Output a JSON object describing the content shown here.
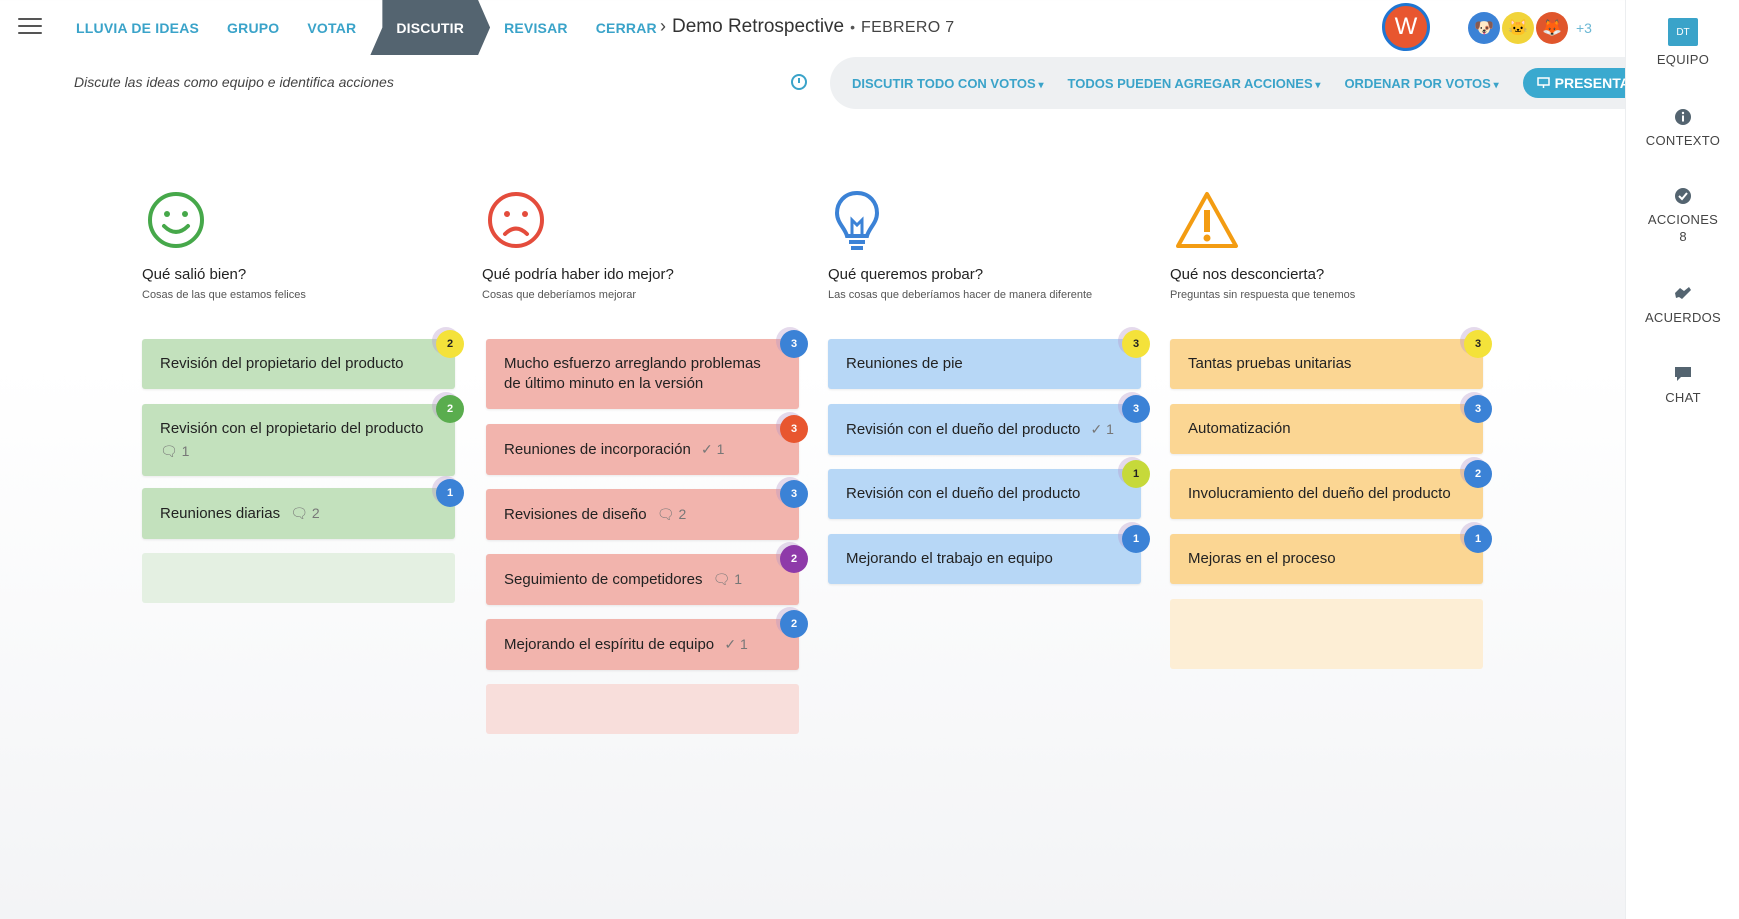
{
  "nav": {
    "steps": [
      {
        "label": "LLUVIA DE IDEAS"
      },
      {
        "label": "GRUPO"
      },
      {
        "label": "VOTAR"
      },
      {
        "label": "DISCUTIR"
      },
      {
        "label": "REVISAR"
      },
      {
        "label": "CERRAR"
      }
    ],
    "active_step": "DISCUTIR"
  },
  "header": {
    "chevron": "›",
    "title": "Demo Retrospective",
    "separator": "•",
    "date": "FEBRERO 7",
    "user_initial": "W",
    "more_participants": "+3"
  },
  "subbar": {
    "subtitle": "Discute las ideas como equipo e identifica acciones",
    "discuss_all": "DISCUTIR TODO CON VOTOS",
    "add_actions": "TODOS PUEDEN AGREGAR ACCIONES",
    "sort": "ORDENAR POR VOTOS",
    "present": "PRESENTAR"
  },
  "sidebar": {
    "team_badge": "DT",
    "team_label": "EQUIPO",
    "context_label": "CONTEXTO",
    "actions_label": "ACCIONES",
    "actions_count": "8",
    "agreements_label": "ACUERDOS",
    "chat_label": "CHAT"
  },
  "columns": [
    {
      "title": "Qué salió bien?",
      "subtitle": "Cosas de las que estamos felices",
      "icon": "smiley-icon",
      "color": "#c3e1bd",
      "cards": [
        {
          "text": "Revisión del propietario del producto",
          "votes": "2",
          "vote_color": "#f4e23a"
        },
        {
          "text": "Revisión con el propietario del producto",
          "comments": "1",
          "votes": "2",
          "vote_color": "#5aad4e"
        },
        {
          "text": "Reuniones diarias",
          "comments": "2",
          "votes": "1",
          "vote_color": "#3b82d6"
        }
      ]
    },
    {
      "title": "Qué podría haber ido mejor?",
      "subtitle": "Cosas que deberíamos mejorar",
      "icon": "sad-face-icon",
      "color": "#f2b4ad",
      "cards": [
        {
          "text": "Mucho esfuerzo arreglando problemas de último minuto en la versión",
          "votes": "3",
          "vote_color": "#3b82d6"
        },
        {
          "text": "Reuniones de incorporación",
          "actions": "1",
          "votes": "3",
          "vote_color": "#e8562f"
        },
        {
          "text": "Revisiones de diseño",
          "comments": "2",
          "votes": "3",
          "vote_color": "#3b82d6"
        },
        {
          "text": "Seguimiento de competidores",
          "comments": "1",
          "votes": "2",
          "vote_color": "#8e3aa9"
        },
        {
          "text": "Mejorando el espíritu de equipo",
          "actions": "1",
          "votes": "2",
          "vote_color": "#3b82d6"
        }
      ]
    },
    {
      "title": "Qué queremos probar?",
      "subtitle": "Las cosas que deberíamos hacer de manera diferente",
      "icon": "lightbulb-icon",
      "color": "#b7d7f6",
      "cards": [
        {
          "text": "Reuniones de pie",
          "votes": "3",
          "vote_color": "#f4e23a"
        },
        {
          "text": "Revisión con el dueño del producto",
          "actions": "1",
          "votes": "3",
          "vote_color": "#3b82d6"
        },
        {
          "text": "Revisión con el dueño del producto",
          "votes": "1",
          "vote_color": "#c6d93a"
        },
        {
          "text": "Mejorando el trabajo en equipo",
          "votes": "1",
          "vote_color": "#3b82d6"
        }
      ]
    },
    {
      "title": "Qué nos desconcierta?",
      "subtitle": "Preguntas sin respuesta que tenemos",
      "icon": "warning-icon",
      "color": "#fbd693",
      "cards": [
        {
          "text": "Tantas pruebas unitarias",
          "votes": "3",
          "vote_color": "#f4e23a"
        },
        {
          "text": "Automatización",
          "votes": "3",
          "vote_color": "#3b82d6"
        },
        {
          "text": "Involucramiento del dueño del producto",
          "votes": "2",
          "vote_color": "#3b82d6"
        },
        {
          "text": "Mejoras en el proceso",
          "votes": "1",
          "vote_color": "#3b82d6"
        }
      ]
    }
  ]
}
